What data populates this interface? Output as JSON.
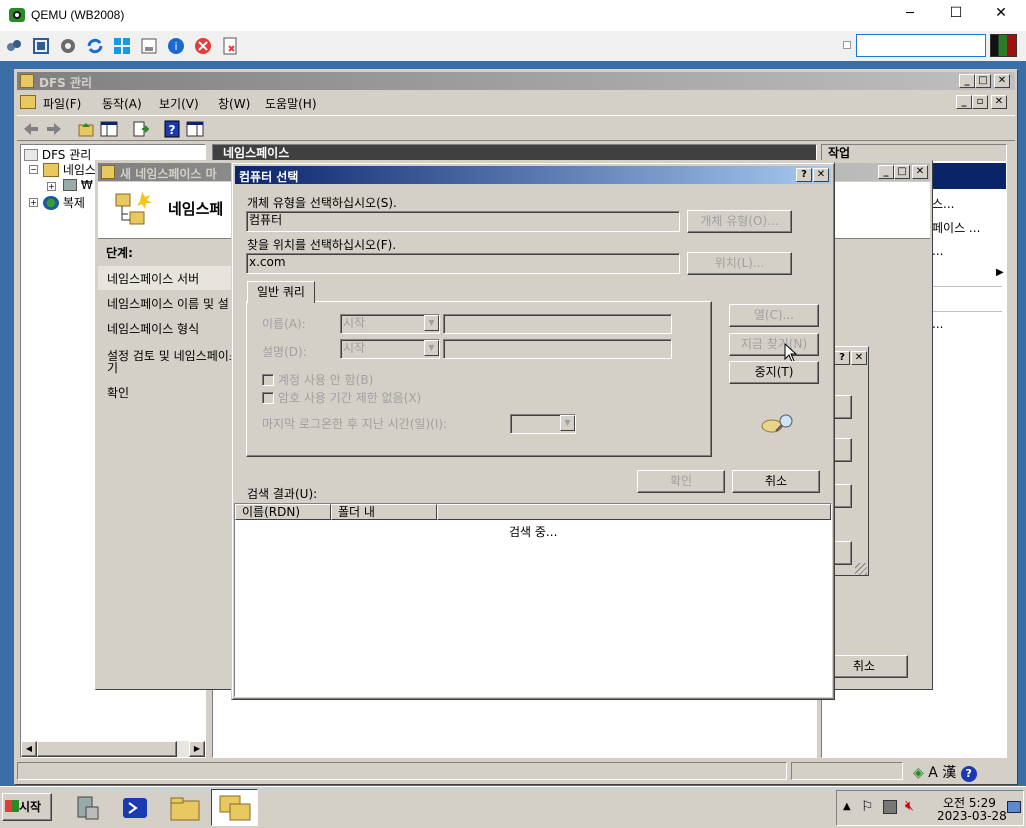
{
  "qemu": {
    "title": "QEMU (WB2008)",
    "min_icon": "─",
    "max_icon": "☐",
    "close_icon": "✕"
  },
  "dfs": {
    "title": "DFS 관리",
    "menu": [
      "파일(F)",
      "동작(A)",
      "보기(V)",
      "창(W)",
      "도움말(H)"
    ],
    "tree_root": "DFS 관리",
    "tree_ns": "네임스",
    "tree_ns_child": "₩",
    "tree_rep": "복제",
    "center_header": "네임스페이스",
    "action_header": "작업",
    "action_items": [
      "스...",
      "페이스 ...",
      "...",
      "..."
    ]
  },
  "wizard": {
    "title": "새 네임스페이스 마",
    "heading": "네임스페",
    "steps_label": "단계:",
    "steps": [
      "네임스페이스 서버",
      "네임스페이스 이름 및 설",
      "네임스페이스 형식",
      "설정 검토 및 네임스페이스 만들",
      "기",
      "확인"
    ],
    "cancel": "취소"
  },
  "dialog": {
    "title": "컴퓨터 선택",
    "help_btn": "?",
    "close_btn": "✕",
    "obj_type_label": "개체 유형을 선택하십시오(S).",
    "obj_type_value": "컴퓨터",
    "obj_type_btn": "개체 유형(O)...",
    "location_label": "찾을 위치를 선택하십시오(F).",
    "location_value": "x.com",
    "location_btn": "위치(L)...",
    "tab": "일반 쿼리",
    "name_label": "이름(A):",
    "name_op": "시작",
    "desc_label": "설명(D):",
    "desc_op": "시작",
    "chk_disabled": "계정 사용 안 함(B)",
    "chk_noexpire": "암호 사용 기간 제한 없음(X)",
    "last_logon_label": "마지막 로그온한 후 지난 시간(일)(I):",
    "columns_btn": "열(C)...",
    "find_now_btn": "지금 찾기(N)",
    "stop_btn": "중지(T)",
    "ok_btn": "확인",
    "cancel_btn": "취소",
    "results_label": "검색 결과(U):",
    "col_name": "이름(RDN)",
    "col_folder": "폴더 내",
    "searching": "검색 중..."
  },
  "taskbar": {
    "start": "시작",
    "time": "오전 5:29",
    "date": "2023-03-28"
  },
  "colors": {
    "title_active": "#0a246a",
    "title_inactive": "#808080",
    "face": "#d4d0c8",
    "desktop": "#3a6ea5"
  }
}
